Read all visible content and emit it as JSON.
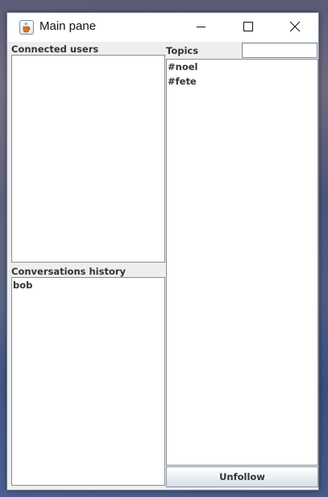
{
  "window": {
    "title": "Main pane",
    "app_icon": "java-coffee-cup-icon",
    "controls": {
      "minimize_icon": "minimize-icon",
      "maximize_icon": "maximize-icon",
      "close_icon": "close-icon"
    }
  },
  "left": {
    "connected_users": {
      "label": "Connected users",
      "items": []
    },
    "conversations_history": {
      "label": "Conversations history",
      "items": [
        "bob"
      ]
    }
  },
  "right": {
    "topics": {
      "label": "Topics",
      "search_value": "",
      "items": [
        "#noel",
        "#fete"
      ]
    },
    "unfollow_label": "Unfollow"
  },
  "colors": {
    "text": "#333333",
    "border": "#8c8c8c",
    "background": "#eeeeee",
    "button_gradient_bottom": "#d6dee8"
  }
}
